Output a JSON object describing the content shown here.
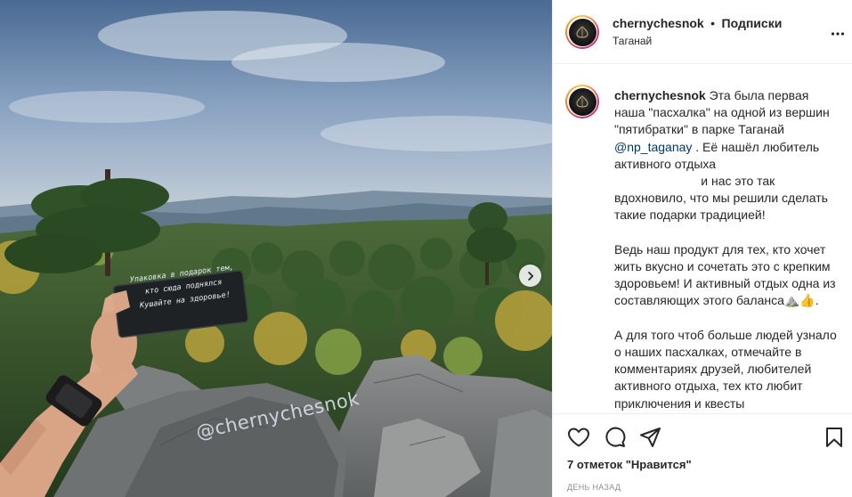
{
  "post": {
    "username": "chernychesnok",
    "separator": "•",
    "follow_label": "Подписки",
    "location": "Таганай",
    "more_icon": "more-horizontal-icon"
  },
  "photo": {
    "sign_lines": [
      "Упаковка в подарок тем,",
      "кто сюда поднялся",
      "Кушайте на здоровье!"
    ],
    "rock_tag": "@chernychesnok",
    "next_icon": "chevron-right-icon"
  },
  "caption": {
    "username": "chernychesnok",
    "part1": " Эта была первая наша \"пасхалка\" на одной из вершин \"пятибратки\" в парке Таганай ",
    "mention": "@np_taganay",
    "part2": " . Её нашёл любитель активного отдыха\n                         и нас это так вдохновило, что мы решили сделать такие подарки традицией!\n\nВедь наш продукт для тех, кто хочет жить вкусно и сочетать это с крепким здоровьем! И активный отдых одна из составляющих этого баланса",
    "emoji": "⛰️👍",
    "part3": ".\n\nА для того чтоб больше людей узнало о наших пасхалках, отмечайте в комментариях друзей, любителей активного отдыха, тех кто любит приключения и квесты"
  },
  "actions": {
    "like_icon": "heart-icon",
    "comment_icon": "comment-icon",
    "share_icon": "share-icon",
    "save_icon": "bookmark-icon",
    "likes_text": "7 отметок \"Нравится\"",
    "time_text": "день назад"
  },
  "colors": {
    "text": "#262626",
    "mention": "#00376b",
    "muted": "#8e8e8e",
    "border": "#efefef"
  }
}
